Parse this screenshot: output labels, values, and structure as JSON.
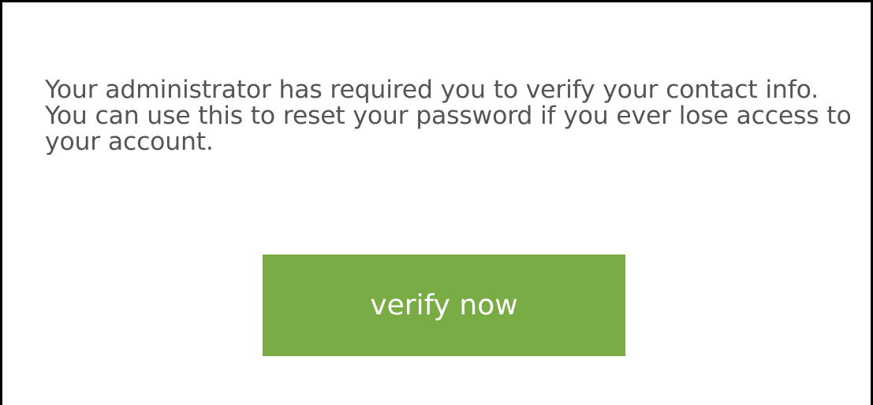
{
  "prompt": {
    "message": "Your administrator has required you to verify your contact info. You can use this to reset your password if you ever lose access to your account."
  },
  "actions": {
    "verify_label": "verify now",
    "verify_color": "#7aac45"
  }
}
